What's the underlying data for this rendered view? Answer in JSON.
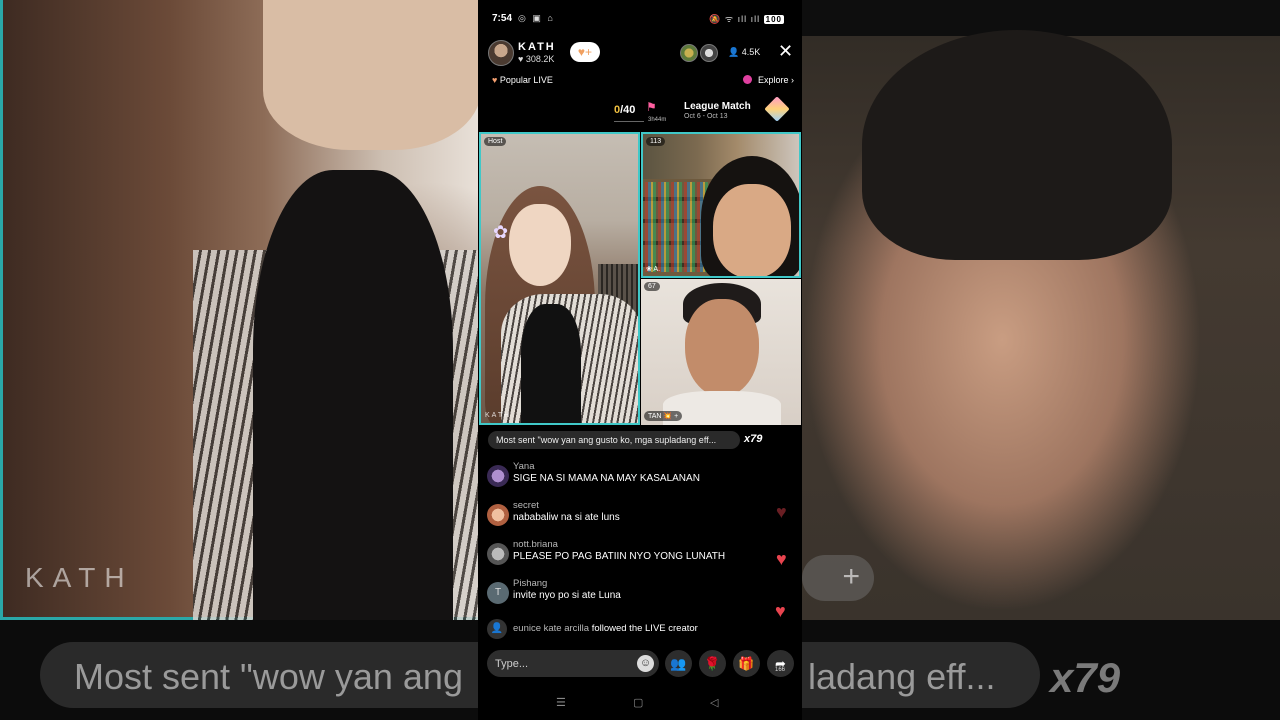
{
  "background": {
    "left_watermark": "KATH",
    "bottom_text_left": "Most sent \"wow yan ang",
    "bottom_text_right": "ladang eff...",
    "bottom_multiplier": "x79",
    "ghost_button_label": "+"
  },
  "status_bar": {
    "time": "7:54",
    "left_icons": "◎ ▣ ⌂",
    "right_icons": "🔕 ᯤ ıll ıll",
    "battery": "100"
  },
  "host": {
    "name": "KATH",
    "likes": "308.2K",
    "likes_icon": "♥",
    "follow_icon": "♥+",
    "viewer_count": "4.5K",
    "viewer_icon": "👤",
    "close_icon": "✕"
  },
  "subheader": {
    "popular_label": "Popular LIVE",
    "popular_icon": "♥",
    "explore_label": "Explore",
    "explore_chevron": "›"
  },
  "league": {
    "count_zero": "0",
    "count_rest": "/40",
    "timer": "3h44m",
    "title": "League Match",
    "dates": "Oct 6 - Oct 13"
  },
  "tiles": {
    "host_tag": "Host",
    "host_watermark": "KATH",
    "guest1_count": "113",
    "guest1_name": "❀ A.",
    "guest2_count": "67",
    "guest2_name": "TAN 💥 +"
  },
  "chat": {
    "most_sent": "Most sent \"wow yan ang gusto ko, mga supladang eff...",
    "most_sent_multiplier": "x79",
    "messages": [
      {
        "user": "Yana",
        "text": "SIGE NA SI MAMA NA MAY KASALANAN",
        "avatar_letter": ""
      },
      {
        "user": "secret",
        "text": "nababaliw na si ate luns",
        "avatar_letter": ""
      },
      {
        "user": "nott.briana",
        "text": "PLEASE PO PAG BATIIN NYO YONG LUNATH",
        "avatar_letter": ""
      },
      {
        "user": "Pishang",
        "text": "invite nyo po si ate Luna",
        "avatar_letter": "T"
      }
    ],
    "follow_event": {
      "user": "eunice kate arcilla",
      "action": "followed the LIVE creator",
      "icon": "👤"
    }
  },
  "composer": {
    "placeholder": "Type...",
    "emoji_icon": "☺",
    "share_count": "166"
  },
  "icons": {
    "heart": "♥",
    "multiguest": "👥",
    "rose": "🌹",
    "gift": "🎁",
    "share": "➦",
    "nav_menu": "☰",
    "nav_home": "▢",
    "nav_back": "◁"
  },
  "colors": {
    "accent_teal": "#40c8c8",
    "heart_red": "#e8444f",
    "explore_pink": "#e040a0",
    "count_gold": "#f0c040"
  }
}
